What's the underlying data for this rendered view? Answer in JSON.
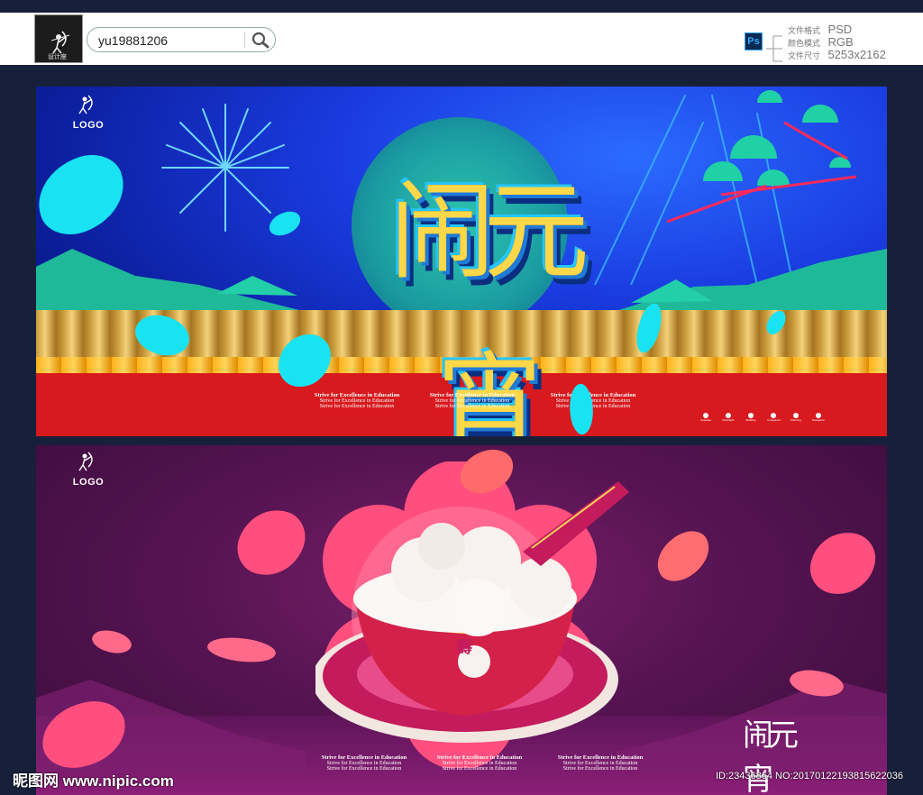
{
  "header": {
    "username": "yu19881206",
    "search_icon": "magnifier-icon",
    "app_badge": "Ps",
    "file_info": [
      {
        "key": "文件格式",
        "value": "PSD"
      },
      {
        "key": "颜色模式",
        "value": "RGB"
      },
      {
        "key": "文件尺寸",
        "value": "5253x2162"
      }
    ]
  },
  "banner1": {
    "logo_text": "LOGO",
    "title": "闹元宵",
    "slogans": [
      {
        "main": "Strive for Excellence in Education",
        "sub1": "Strive for Excellence in Education",
        "sub2": "Strive for Excellence in Education"
      },
      {
        "main": "Strive for Excellence in Education",
        "sub1": "Strive for Excellence in Education",
        "sub2": "Strive for Excellence in Education"
      },
      {
        "main": "Strive for Excellence in Education",
        "sub1": "Strive for Excellence in Education",
        "sub2": "Strive for Excellence in Education"
      }
    ],
    "icons": [
      "Appraise",
      "Moonlight",
      "Building",
      "Companion",
      "Planning",
      "Navigation"
    ]
  },
  "banner2": {
    "logo_text": "LOGO",
    "stamp_title": "闹元宵",
    "slogans": [
      {
        "main": "Strive for Excellence in Education",
        "sub1": "Strive for Excellence in Education",
        "sub2": "Strive for Excellence in Education"
      },
      {
        "main": "Strive for Excellence in Education",
        "sub1": "Strive for Excellence in Education",
        "sub2": "Strive for Excellence in Education"
      },
      {
        "main": "Strive for Excellence in Education",
        "sub1": "Strive for Excellence in Education",
        "sub2": "Strive for Excellence in Education"
      }
    ],
    "bowl_char": "壽"
  },
  "footer": {
    "site_watermark": "昵图网 www.nipic.com",
    "id_watermark": "ID:23436864 NO:20170122193815622036"
  },
  "colors": {
    "page_bg": "#17203a",
    "banner1_blue": "#1a3be0",
    "banner1_red": "#d8191e",
    "title_gold": "#ffd84a",
    "banner2_purple": "#561451",
    "petal_pink": "#ff4f7e",
    "petal_cyan": "#19e3f2"
  }
}
